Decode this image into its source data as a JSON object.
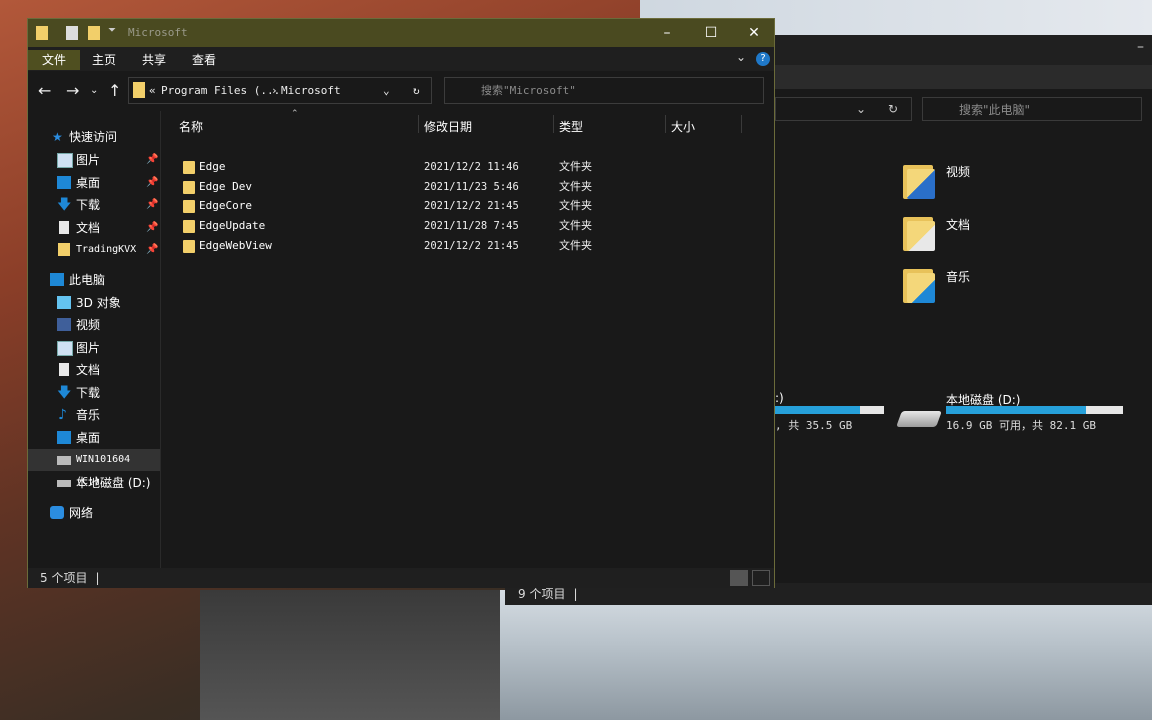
{
  "back_window": {
    "search_placeholder": "搜索\"此电脑\"",
    "folders": [
      {
        "label": "视频",
        "icon": "video-folder-icon"
      },
      {
        "label": "文档",
        "icon": "documents-folder-icon"
      },
      {
        "label": "音乐",
        "icon": "music-folder-icon"
      }
    ],
    "drive_c": {
      "name": ":)",
      "space": ", 共 35.5 GB",
      "fill_fraction": 0.78
    },
    "drive_d": {
      "name": "本地磁盘 (D:)",
      "space": "16.9 GB 可用，共 82.1 GB",
      "fill_fraction": 0.79
    },
    "status": "9 个项目"
  },
  "window": {
    "title": "Microsoft",
    "ribbon_tabs": [
      "文件",
      "主页",
      "共享",
      "查看"
    ],
    "address": {
      "prefix": "«",
      "segment1": "Program Files (...",
      "segment2": "Microsoft"
    },
    "search_placeholder": "搜索\"Microsoft\"",
    "nav": {
      "quick_access": "快速访问",
      "quick_items": [
        "图片",
        "桌面",
        "下载",
        "文档",
        "TradingKVX"
      ],
      "this_pc": "此电脑",
      "pc_items": [
        "3D 对象",
        "视频",
        "图片",
        "文档",
        "下载",
        "音乐",
        "桌面",
        "WIN101604 (C:)",
        "本地磁盘 (D:)"
      ],
      "network": "网络"
    },
    "columns": [
      "名称",
      "修改日期",
      "类型",
      "大小"
    ],
    "files": [
      {
        "name": "Edge",
        "date": "2021/12/2 11:46",
        "type": "文件夹"
      },
      {
        "name": "Edge Dev",
        "date": "2021/11/23 5:46",
        "type": "文件夹"
      },
      {
        "name": "EdgeCore",
        "date": "2021/12/2 21:45",
        "type": "文件夹"
      },
      {
        "name": "EdgeUpdate",
        "date": "2021/11/28 7:45",
        "type": "文件夹"
      },
      {
        "name": "EdgeWebView",
        "date": "2021/12/2 21:45",
        "type": "文件夹"
      }
    ],
    "status": "5 个项目"
  },
  "colors": {
    "accent": "#4f4f20",
    "folder": "#f2cf6a",
    "drive_fill": "#26a0da"
  }
}
